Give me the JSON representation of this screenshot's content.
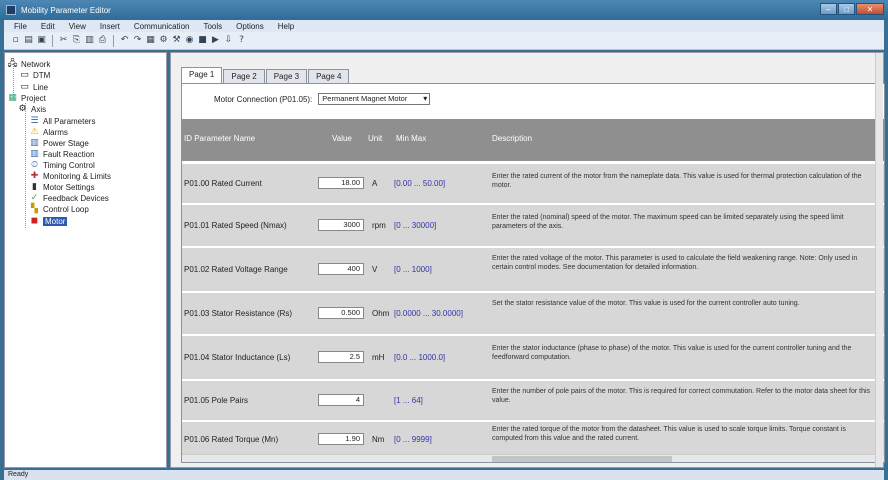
{
  "title": "Mobility Parameter Editor",
  "menu": [
    "File",
    "Edit",
    "View",
    "Insert",
    "Communication",
    "Tools",
    "Options",
    "Help"
  ],
  "tree": [
    {
      "label": "Network",
      "icon": "network-icon",
      "glyph": "🖧"
    },
    {
      "label": "DTM",
      "icon": "device-icon",
      "glyph": "▭"
    },
    {
      "label": "Line",
      "icon": "line-icon",
      "glyph": "▭"
    },
    {
      "label": "Project",
      "icon": "project-icon",
      "glyph": "▦"
    },
    {
      "label": "Axis",
      "icon": "axis-icon",
      "glyph": "⚙"
    },
    {
      "label": "All Parameters",
      "icon": "list-icon",
      "glyph": "☰"
    },
    {
      "label": "Alarms",
      "icon": "warning-icon",
      "glyph": "⚠"
    },
    {
      "label": "Power Stage",
      "icon": "power-icon",
      "glyph": "▥"
    },
    {
      "label": "Fault Reaction",
      "icon": "fault-icon",
      "glyph": "▥"
    },
    {
      "label": "Timing Control",
      "icon": "timing-icon",
      "glyph": "⏲"
    },
    {
      "label": "Monitoring & Limits",
      "icon": "monitor-icon",
      "glyph": "✚"
    },
    {
      "label": "Motor Settings",
      "icon": "motor-icon",
      "glyph": "▮"
    },
    {
      "label": "Feedback Devices",
      "icon": "feedback-icon",
      "glyph": "✓"
    },
    {
      "label": "Control Loop",
      "icon": "loop-icon",
      "glyph": "▚"
    },
    {
      "label": "Motor",
      "icon": "motor-red-icon",
      "glyph": "◼"
    }
  ],
  "tabs": [
    "Page 1",
    "Page 2",
    "Page 3",
    "Page 4"
  ],
  "selector": {
    "label": "Motor Connection (P01.05):",
    "value": "Permanent Magnet Motor"
  },
  "columns": {
    "name": "ID  Parameter Name",
    "value": "Value",
    "unit": "Unit",
    "range": "Min  Max",
    "desc": "Description"
  },
  "rows": [
    {
      "name": "P01.00 Rated Current",
      "value": "18.00",
      "unit": "A",
      "range": "[0.00 ... 50.00]",
      "desc": "Enter the rated current of the motor from the nameplate data. This value is used for thermal protection calculation of the motor."
    },
    {
      "name": "P01.01 Rated Speed (Nmax)",
      "value": "3000",
      "unit": "rpm",
      "range": "[0 ... 30000]",
      "desc": "Enter the rated (nominal) speed of the motor. The maximum speed can be limited separately using the speed limit parameters of the axis."
    },
    {
      "name": "P01.02 Rated Voltage Range",
      "value": "400",
      "unit": "V",
      "range": "[0 ... 1000]",
      "desc": "Enter the rated voltage of the motor. This parameter is used to calculate the field weakening range. Note: Only used in certain control modes. See documentation for detailed information."
    },
    {
      "name": "P01.03 Stator Resistance (Rs)",
      "value": "0.500",
      "unit": "Ohm",
      "range": "[0.0000 ... 30.0000]",
      "desc": "Set the stator resistance value of the motor. This value is used for the current controller auto tuning."
    },
    {
      "name": "P01.04 Stator Inductance (Ls)",
      "value": "2.5",
      "unit": "mH",
      "range": "[0.0 ... 1000.0]",
      "desc": "Enter the stator inductance (phase to phase) of the motor. This value is used for the current controller tuning and the feedforward computation."
    },
    {
      "name": "P01.05 Pole Pairs",
      "value": "4",
      "unit": "",
      "range": "[1 ... 64]",
      "desc": "Enter the number of pole pairs of the motor. This is required for correct commutation. Refer to the motor data sheet for this value."
    },
    {
      "name": "P01.06 Rated Torque (Mn)",
      "value": "1.90",
      "unit": "Nm",
      "range": "[0 ... 9999]",
      "desc": "Enter the rated torque of the motor from the datasheet. This value is used to scale torque limits. Torque constant is computed from this value and the rated current."
    }
  ],
  "status": "Ready"
}
